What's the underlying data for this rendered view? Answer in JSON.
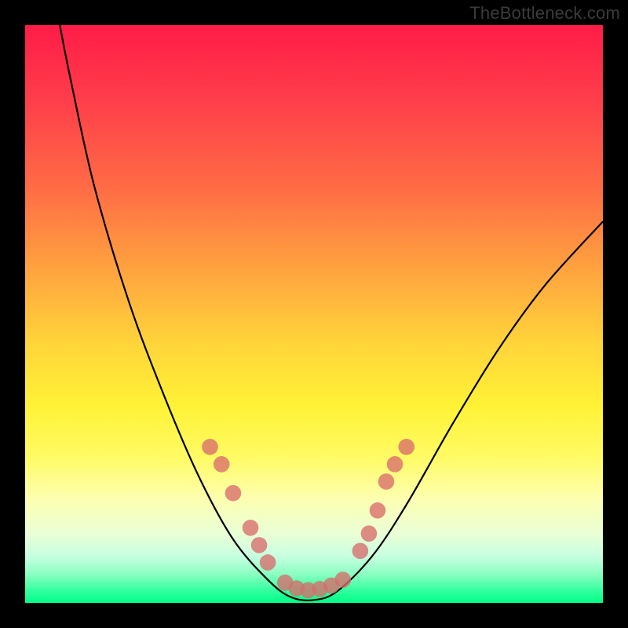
{
  "watermark_text": "TheBottleneck.com",
  "colors": {
    "frame": "#000000",
    "curve_stroke": "#000000",
    "dot_fill": "#d86b6b",
    "gradient_stops": [
      "#ff1c47",
      "#ff3b4a",
      "#ff6b45",
      "#ffa23f",
      "#ffd43a",
      "#fff236",
      "#fffb66",
      "#fdffb0",
      "#eaffd6",
      "#c6ffe0",
      "#8cffc1",
      "#2fff9e",
      "#00ff88"
    ]
  },
  "chart_data": {
    "type": "line",
    "title": "",
    "xlabel": "",
    "ylabel": "",
    "xlim": [
      0,
      100
    ],
    "ylim": [
      0,
      100
    ],
    "axes_visible": false,
    "legend_visible": false,
    "series": [
      {
        "name": "bottleneck-curve",
        "points": [
          {
            "x": 6,
            "y": 100
          },
          {
            "x": 8,
            "y": 90
          },
          {
            "x": 12,
            "y": 72
          },
          {
            "x": 18,
            "y": 52
          },
          {
            "x": 24,
            "y": 36
          },
          {
            "x": 30,
            "y": 22
          },
          {
            "x": 36,
            "y": 11
          },
          {
            "x": 42,
            "y": 4
          },
          {
            "x": 46,
            "y": 1
          },
          {
            "x": 50,
            "y": 0.5
          },
          {
            "x": 54,
            "y": 2
          },
          {
            "x": 60,
            "y": 8
          },
          {
            "x": 66,
            "y": 17
          },
          {
            "x": 74,
            "y": 31
          },
          {
            "x": 82,
            "y": 44
          },
          {
            "x": 90,
            "y": 55
          },
          {
            "x": 100,
            "y": 66
          }
        ]
      }
    ],
    "dots": [
      {
        "x": 32,
        "y": 27
      },
      {
        "x": 34,
        "y": 24
      },
      {
        "x": 36,
        "y": 19
      },
      {
        "x": 39,
        "y": 13
      },
      {
        "x": 40.5,
        "y": 10
      },
      {
        "x": 42,
        "y": 7
      },
      {
        "x": 45,
        "y": 3.5
      },
      {
        "x": 47,
        "y": 2.5
      },
      {
        "x": 49,
        "y": 2.2
      },
      {
        "x": 51,
        "y": 2.4
      },
      {
        "x": 53,
        "y": 3
      },
      {
        "x": 55,
        "y": 4
      },
      {
        "x": 58,
        "y": 9
      },
      {
        "x": 59.5,
        "y": 12
      },
      {
        "x": 61,
        "y": 16
      },
      {
        "x": 62.5,
        "y": 21
      },
      {
        "x": 64,
        "y": 24
      },
      {
        "x": 66,
        "y": 27
      }
    ],
    "dot_radius": 1.4
  }
}
